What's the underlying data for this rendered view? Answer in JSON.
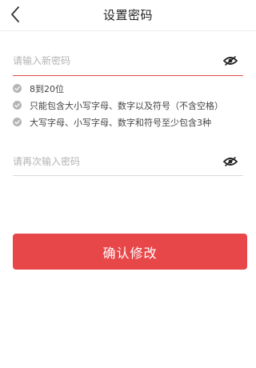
{
  "header": {
    "title": "设置密码",
    "back_icon": "chevron-left-icon"
  },
  "password_field": {
    "placeholder": "请输入新密码",
    "value": "",
    "toggle_icon": "eye-hidden-icon"
  },
  "rules": [
    {
      "text": "8到20位",
      "icon": "check-circle-icon"
    },
    {
      "text": "只能包含大小写字母、数字以及符号（不含空格）",
      "icon": "check-circle-icon"
    },
    {
      "text": "大写字母、小写字母、数字和符号至少包含3种",
      "icon": "check-circle-icon"
    }
  ],
  "confirm_field": {
    "placeholder": "请再次输入密码",
    "value": "",
    "toggle_icon": "eye-hidden-icon"
  },
  "confirm_button": {
    "label": "确认修改"
  },
  "colors": {
    "accent": "#e8474a",
    "check_gray": "#b5b5b5",
    "placeholder": "#b3b3b3"
  }
}
